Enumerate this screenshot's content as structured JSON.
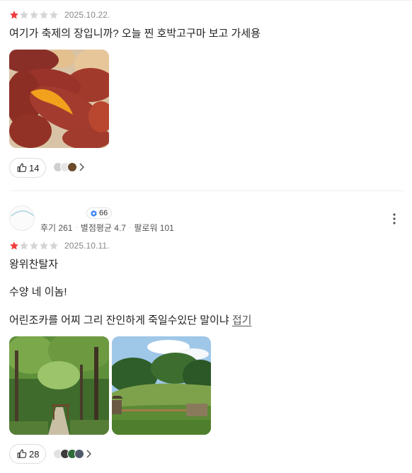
{
  "review1": {
    "date": "2025.10.22.",
    "rating": 1,
    "text": "여기가 축제의 장입니까? 오늘 찐 호박고구마 보고 가세용",
    "photo_alt": "baked sweet potatoes and eggs",
    "likes": "14"
  },
  "review2": {
    "badge_count": "66",
    "stats": {
      "reviews": "후기 261",
      "avg": "별점평균 4.7",
      "followers": "팔로워 101"
    },
    "date": "2025.10.11.",
    "rating": 1,
    "lines": [
      "왕위찬탈자",
      "수양 네 이놈!",
      "어린조카를 어찌 그리 잔인하게 죽일수있단 말이냐"
    ],
    "more_label": "접기",
    "photo1_alt": "forest path with wooden gate",
    "photo2_alt": "grassy burial mound and trees",
    "likes": "28"
  },
  "icons": {
    "star_filled": "star-filled-icon",
    "star_empty": "star-empty-icon",
    "like": "thumbs-up-icon",
    "chevron": "chevron-right-icon",
    "more": "kebab-menu-icon",
    "badge": "hexagon-badge-icon"
  },
  "colors": {
    "star_filled": "#f03e3e",
    "star_empty": "#d5d5d5",
    "badge_icon": "#3d86f5"
  }
}
